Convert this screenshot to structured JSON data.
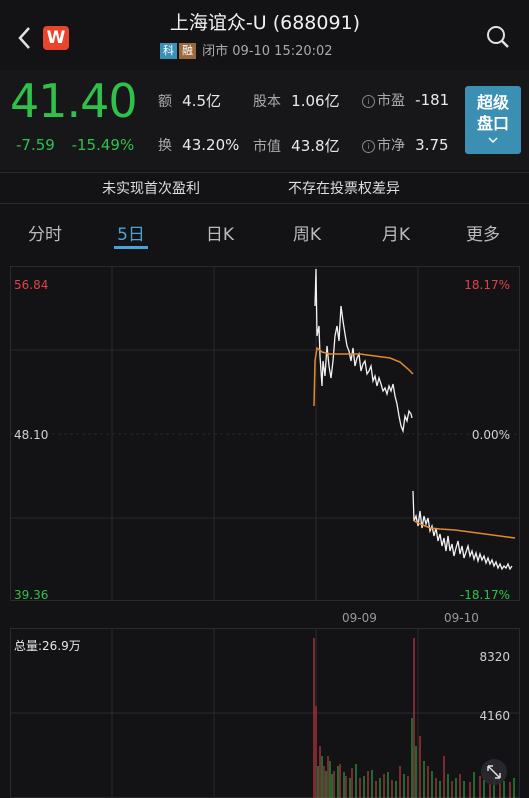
{
  "header": {
    "title": "上海谊众-U (688091)",
    "tag_ke": "科",
    "tag_rong": "融",
    "status": "闭市 09-10 15:20:02",
    "logo_letter": "W"
  },
  "quote": {
    "price": "41.40",
    "change": "-7.59",
    "change_pct": "-15.49%",
    "stats": [
      {
        "label": "额",
        "value": "4.5亿"
      },
      {
        "label": "股本",
        "value": "1.06亿"
      },
      {
        "label": "市盈",
        "value": "-181"
      },
      {
        "label": "换",
        "value": "43.20%"
      },
      {
        "label": "市值",
        "value": "43.8亿"
      },
      {
        "label": "市净",
        "value": "3.75"
      }
    ],
    "super_button": {
      "line1": "超级",
      "line2": "盘口"
    }
  },
  "notices": {
    "left": "未实现首次盈利",
    "right": "不存在投票权差异"
  },
  "tabs": [
    {
      "label": "分时"
    },
    {
      "label": "5日"
    },
    {
      "label": "日K"
    },
    {
      "label": "周K"
    },
    {
      "label": "月K"
    },
    {
      "label": "更多"
    }
  ],
  "chart_labels": {
    "y_high": "56.84",
    "y_mid": "48.10",
    "y_low": "39.36",
    "pct_high": "18.17%",
    "pct_mid": "0.00%",
    "pct_low": "-18.17%",
    "date1": "09-09",
    "date2": "09-10",
    "volume_label": "总量:26.9万",
    "vol_top": "8320",
    "vol_mid": "4160"
  },
  "colors": {
    "up": "#e0414a",
    "down": "#2ec24a",
    "accent": "#3b8fb2",
    "avg_line": "#e08a2a"
  },
  "chart_data": {
    "type": "line",
    "ylim": [
      39.36,
      56.84
    ],
    "x": [
      "09-09",
      "09-10"
    ],
    "series": [
      {
        "name": "",
        "values": [
          57.0,
          50.8,
          53.2,
          51.0,
          49.2,
          48.4
        ]
      },
      {
        "name": "",
        "values": [
          44.6,
          42.4,
          41.8,
          41.6,
          41.4,
          41.2
        ]
      }
    ]
  }
}
